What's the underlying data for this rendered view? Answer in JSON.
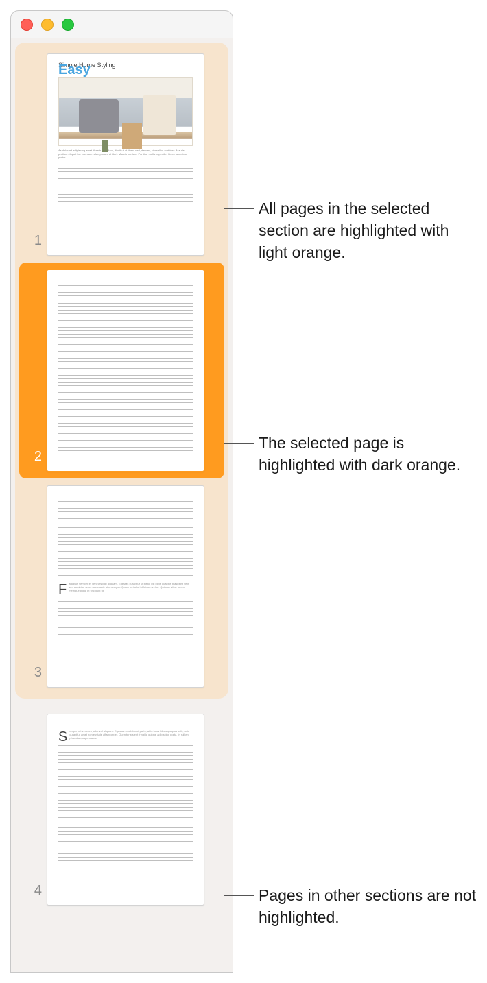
{
  "thumbnails": {
    "doc_title": "Simple Home Styling",
    "doc_subtitle": "Easy",
    "caption": "As dolor ad adipiscing amet tibarutum nullam, dipsit ut ut libero sed, dem ex, phasellus aretrices. Mauris pretium eliquot toc interdum rulen posure et libirt. Mauris pretium. Porttitor mulla imperdiet libero senectus portar.",
    "pages": [
      {
        "num": "1",
        "kind": "cover"
      },
      {
        "num": "2",
        "kind": "text"
      },
      {
        "num": "3",
        "kind": "dropcap"
      },
      {
        "num": "4",
        "kind": "dropcap"
      }
    ]
  },
  "annotations": {
    "a1": "All pages in the selected section are highlighted with light orange.",
    "a2": "The selected page is highlighted with dark orange.",
    "a3": "Pages in other sections are not highlighted."
  }
}
